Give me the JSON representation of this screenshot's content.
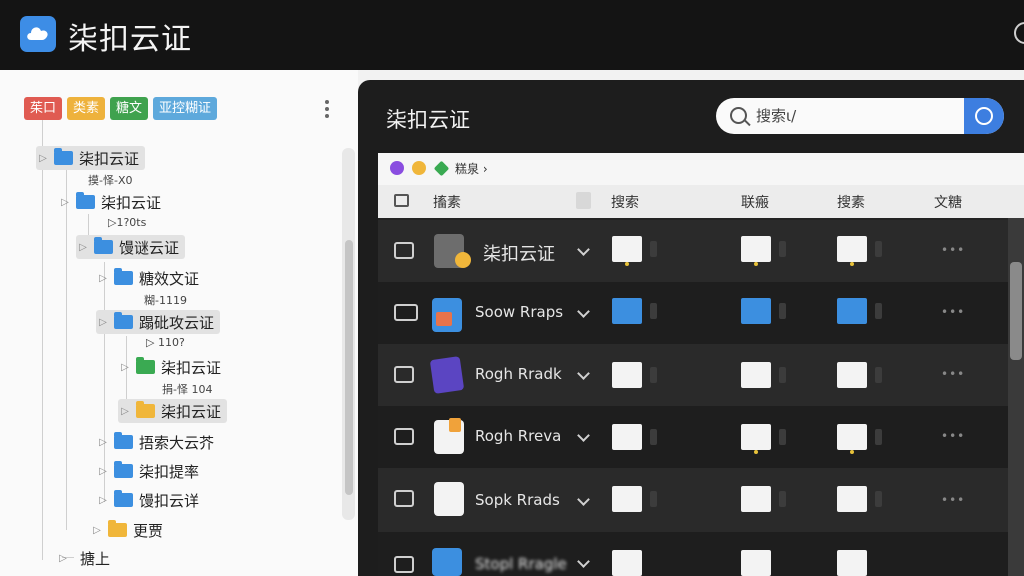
{
  "app": {
    "title": "柒扣云证"
  },
  "tags": [
    "茱口",
    "类素",
    "糖文",
    "亚控糊证"
  ],
  "tree": [
    {
      "label": "柒扣云证",
      "sub": "摸-怿-X0"
    },
    {
      "label": "柒扣云证",
      "sub": "▷1?0ts"
    },
    {
      "label": "馒谜云证",
      "sub": ""
    },
    {
      "label": "糖效文证",
      "sub": "糊-1119"
    },
    {
      "label": "蹋砒攻云证",
      "sub": "▷ 110?"
    },
    {
      "label": "柒扣云证",
      "sub": "捐-怿 104"
    },
    {
      "label": "柒扣云证",
      "sub": ""
    },
    {
      "label": "捂索大云芥",
      "sub": ""
    },
    {
      "label": "柒扣提率",
      "sub": ""
    },
    {
      "label": "馒扣云详",
      "sub": ""
    },
    {
      "label": "更贾",
      "sub": ""
    },
    {
      "label": "搪上",
      "sub": ""
    }
  ],
  "panel": {
    "title": "柒扣云证",
    "search_placeholder": "搜索ι/",
    "breadcrumb": "糕泉 ›",
    "columns": [
      "搐素",
      "搜索",
      "联瘢",
      "搜素",
      "文糖"
    ],
    "rows": [
      {
        "name": "柒扣云证",
        "more": "•••"
      },
      {
        "name": "Soow Rraps",
        "more": "•••"
      },
      {
        "name": "Rogh Rradk",
        "more": "•••"
      },
      {
        "name": "Rogh Rreva",
        "more": "•••"
      },
      {
        "name": "Sopk Rrads",
        "more": "•••"
      },
      {
        "name": "Stopl Rragle",
        "more": ""
      }
    ]
  },
  "colors": {
    "header_bg": "#141414",
    "panel_bg": "#1d1d1d",
    "accent_blue": "#3d7ee0",
    "folder_blue": "#3c8fe0",
    "folder_green": "#3aaa52",
    "folder_yellow": "#f0b63a",
    "tag_red": "#e05b52",
    "tag_yellow": "#eeb23c",
    "tag_green": "#3fa24e",
    "tag_blue": "#5ea9dc"
  },
  "icons": [
    "cloud-logo-icon",
    "more-vertical-icon",
    "folder-icon",
    "search-icon",
    "settings-circle-icon",
    "file-icon",
    "chevron-down-icon",
    "ellipsis-icon"
  ]
}
